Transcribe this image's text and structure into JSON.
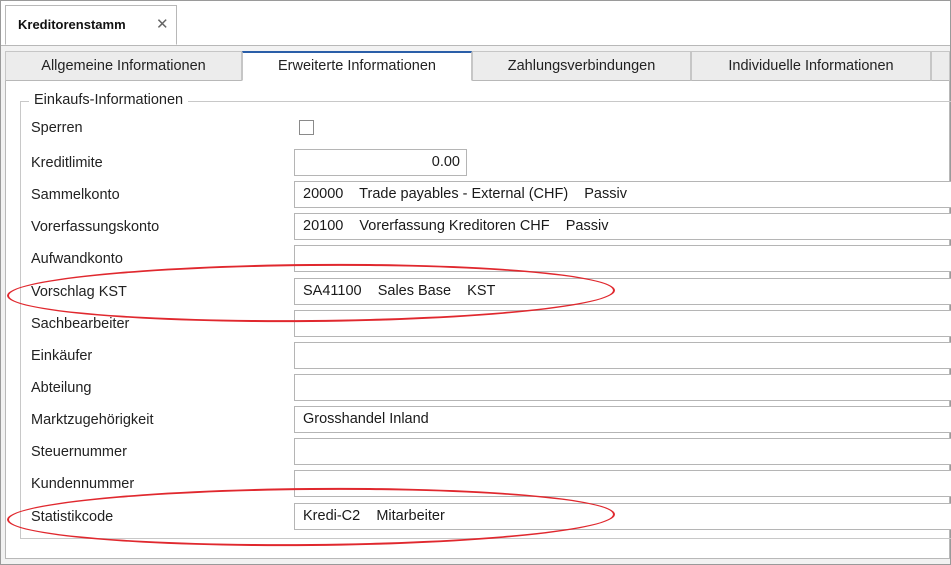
{
  "document_tab": {
    "title": "Kreditorenstamm",
    "close_glyph": "✕"
  },
  "tabs": [
    {
      "label": "Allgemeine Informationen",
      "active": false
    },
    {
      "label": "Erweiterte Informationen",
      "active": true
    },
    {
      "label": "Zahlungsverbindungen",
      "active": false
    },
    {
      "label": "Individuelle Informationen",
      "active": false
    }
  ],
  "group": {
    "title": "Einkaufs-Informationen"
  },
  "fields": {
    "sperren": {
      "label": "Sperren",
      "checked": false
    },
    "kreditlimite": {
      "label": "Kreditlimite",
      "value": "0.00"
    },
    "sammelkonto": {
      "label": "Sammelkonto",
      "value": "20000    Trade payables - External (CHF)    Passiv"
    },
    "vorerfassungskonto": {
      "label": "Vorerfassungskonto",
      "value": "20100    Vorerfassung Kreditoren CHF    Passiv"
    },
    "aufwandkonto": {
      "label": "Aufwandkonto",
      "value": ""
    },
    "vorschlag_kst": {
      "label": "Vorschlag KST",
      "value": "SA41100    Sales Base    KST"
    },
    "sachbearbeiter": {
      "label": "Sachbearbeiter",
      "value": ""
    },
    "einkaeufer": {
      "label": "Einkäufer",
      "value": ""
    },
    "abteilung": {
      "label": "Abteilung",
      "value": ""
    },
    "marktzugehoerigkeit": {
      "label": "Marktzugehörigkeit",
      "value": "Grosshandel Inland"
    },
    "steuernummer": {
      "label": "Steuernummer",
      "value": ""
    },
    "kundennummer": {
      "label": "Kundennummer",
      "value": ""
    },
    "statistikcode": {
      "label": "Statistikcode",
      "value": "Kredi-C2    Mitarbeiter"
    }
  },
  "colors": {
    "highlight": "#e0282e",
    "active_tab_accent": "#2a5ea8"
  }
}
